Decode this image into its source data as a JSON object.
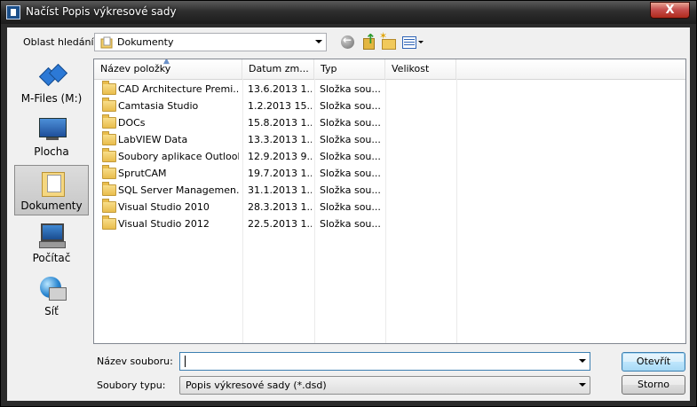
{
  "window": {
    "title": "Načíst Popis výkresové sady",
    "close_label": "X"
  },
  "toolbar": {
    "lookin_label": "Oblast hledání:",
    "lookin_value": "Dokumenty"
  },
  "places": [
    {
      "label": "M-Files (M:)",
      "icon": "mfiles-icon"
    },
    {
      "label": "Plocha",
      "icon": "desktop-icon"
    },
    {
      "label": "Dokumenty",
      "icon": "documents-folder-icon"
    },
    {
      "label": "Počítač",
      "icon": "computer-icon"
    },
    {
      "label": "Síť",
      "icon": "network-icon"
    }
  ],
  "columns": {
    "name": "Název položky",
    "date": "Datum zm...",
    "type": "Typ",
    "size": "Velikost"
  },
  "files": [
    {
      "name": "CAD Architecture Premi...",
      "date": "13.6.2013 1...",
      "type": "Složka sou...",
      "size": ""
    },
    {
      "name": "Camtasia Studio",
      "date": "1.2.2013 15...",
      "type": "Složka sou...",
      "size": ""
    },
    {
      "name": "DOCs",
      "date": "15.8.2013 1...",
      "type": "Složka sou...",
      "size": ""
    },
    {
      "name": "LabVIEW Data",
      "date": "13.3.2013 1...",
      "type": "Složka sou...",
      "size": ""
    },
    {
      "name": "Soubory aplikace Outlook",
      "date": "12.9.2013 9...",
      "type": "Složka sou...",
      "size": ""
    },
    {
      "name": "SprutCAM",
      "date": "19.7.2013 1...",
      "type": "Složka sou...",
      "size": ""
    },
    {
      "name": "SQL Server Managemen...",
      "date": "31.1.2013 1...",
      "type": "Složka sou...",
      "size": ""
    },
    {
      "name": "Visual Studio 2010",
      "date": "28.3.2013 1...",
      "type": "Složka sou...",
      "size": ""
    },
    {
      "name": "Visual Studio 2012",
      "date": "22.5.2013 1...",
      "type": "Složka sou...",
      "size": ""
    }
  ],
  "filename": {
    "label": "Název souboru:",
    "value": ""
  },
  "filetype": {
    "label": "Soubory typu:",
    "value": "Popis výkresové sady (*.dsd)"
  },
  "buttons": {
    "open": "Otevřít",
    "cancel": "Storno"
  }
}
